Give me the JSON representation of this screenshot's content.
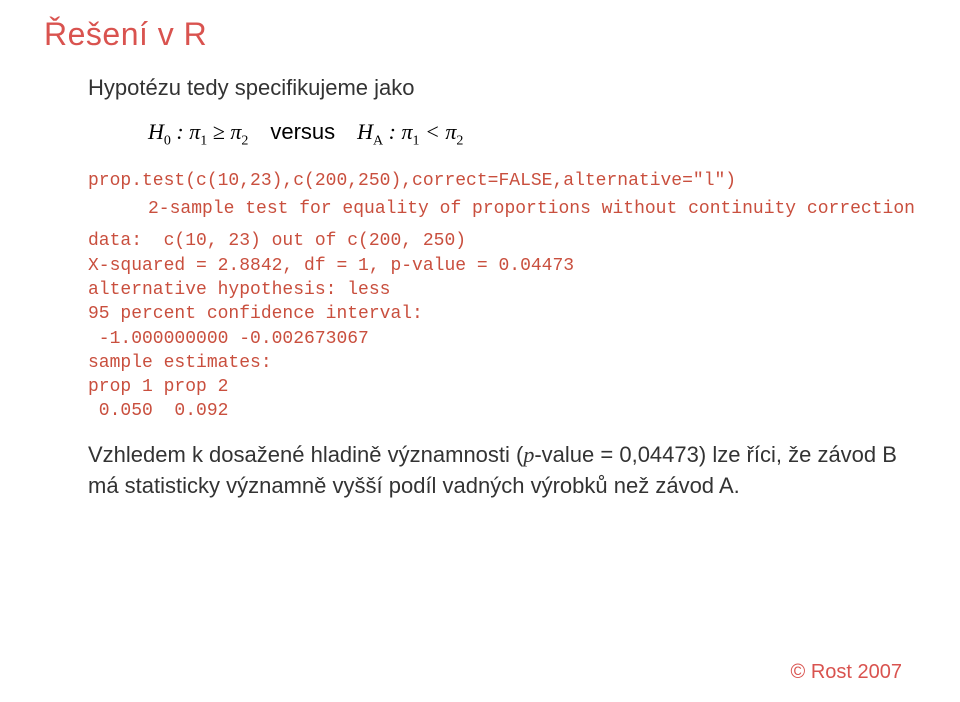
{
  "title": "Řešení v R",
  "intro": "Hypotézu tedy specifikujeme jako",
  "formula": {
    "h0_symbol": "H",
    "h0_sub": "0",
    "colon": " : ",
    "pi": "π",
    "sub1": "1",
    "ge": " ≥ ",
    "sub2": "2",
    "versus": "versus",
    "ha_symbol": "H",
    "ha_sub": "A",
    "lt": " < "
  },
  "code_call": "prop.test(c(10,23),c(200,250),correct=FALSE,alternative=\"l\")",
  "code_header": "2-sample test for equality of proportions without continuity correction",
  "code_body": "data:  c(10, 23) out of c(200, 250)\nX-squared = 2.8842, df = 1, p-value = 0.04473\nalternative hypothesis: less\n95 percent confidence interval:\n -1.000000000 -0.002673067\nsample estimates:\nprop 1 prop 2\n 0.050  0.092",
  "conclusion_part1": "Vzhledem k dosažené hladině významnosti (",
  "conclusion_pvar": "p",
  "conclusion_part2": "-value = 0,04473) lze říci, že závod B má statisticky významně vyšší podíl vadných výrobků než závod A.",
  "footer": "© Rost 2007"
}
